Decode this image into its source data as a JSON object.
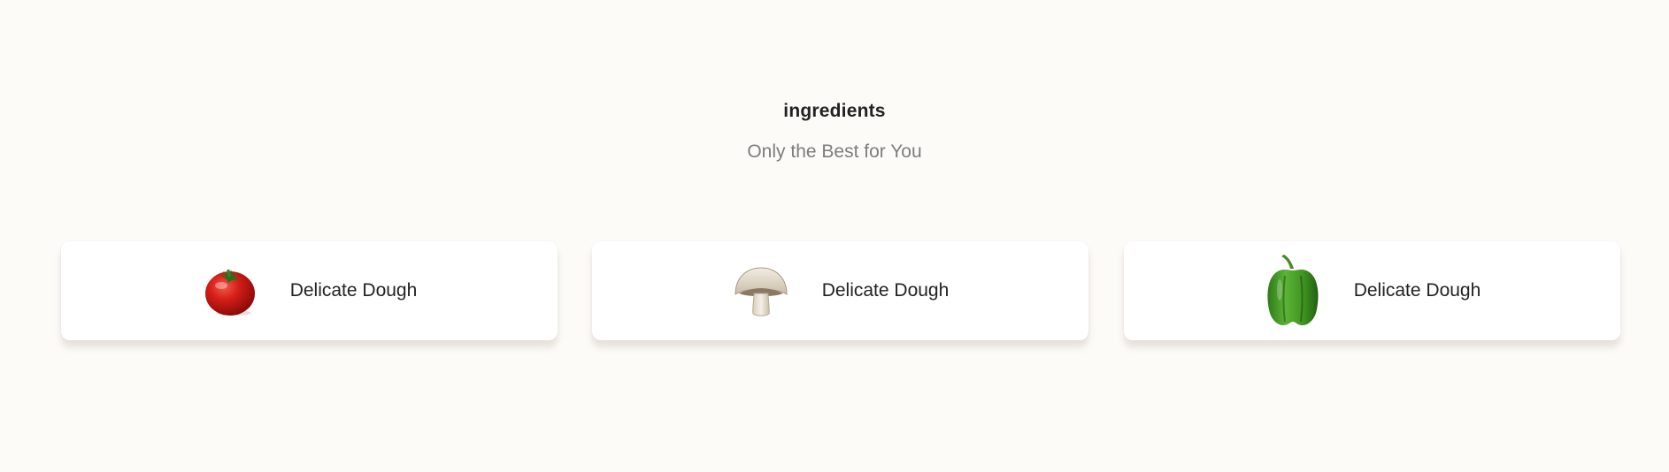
{
  "section": {
    "title": "ingredients",
    "subtitle": "Only the Best for You"
  },
  "ingredients": [
    {
      "label": "Delicate Dough",
      "icon": "tomato-icon"
    },
    {
      "label": "Delicate Dough",
      "icon": "mushroom-icon"
    },
    {
      "label": "Delicate Dough",
      "icon": "bell-pepper-icon"
    }
  ],
  "colors": {
    "background": "#fdfbf8",
    "card": "#ffffff",
    "title": "#222222",
    "subtitle": "#7d7d7d"
  }
}
